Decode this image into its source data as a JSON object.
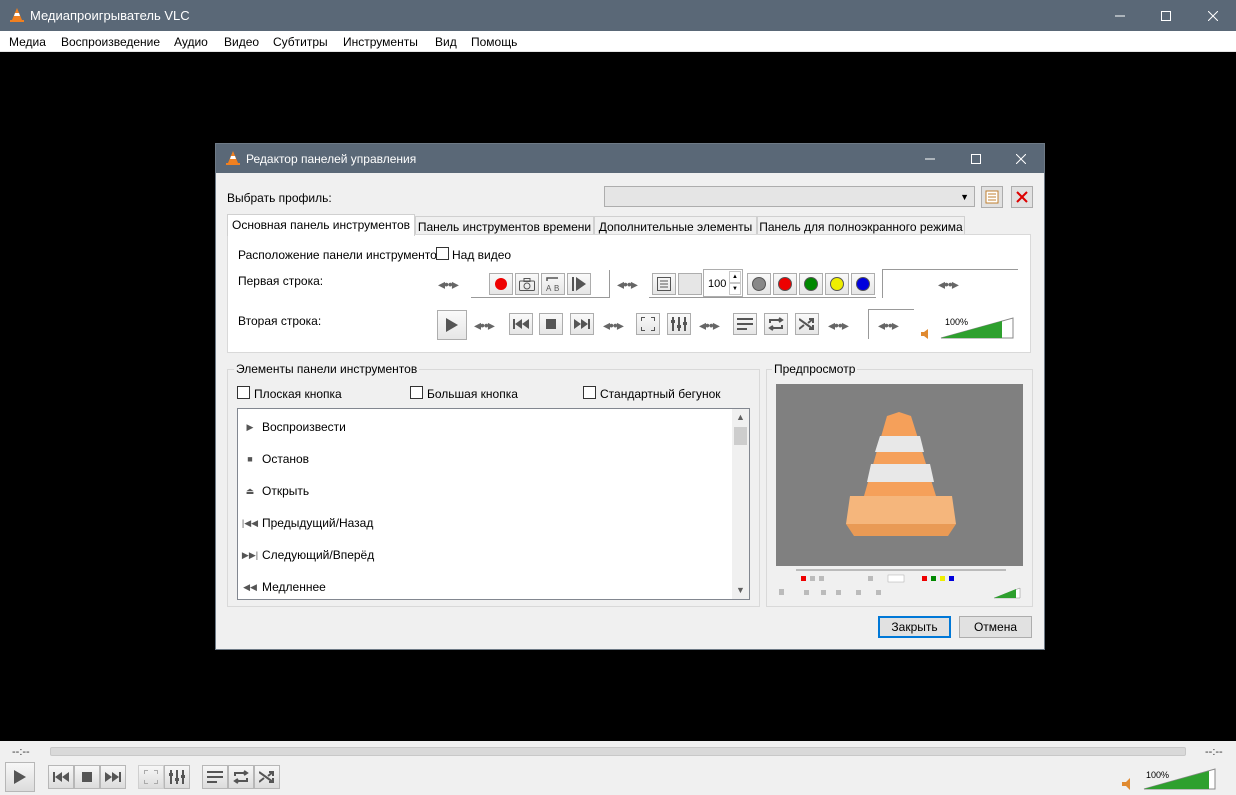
{
  "window": {
    "title": "Медиапроигрыватель VLC"
  },
  "menu": [
    "Медиа",
    "Воспроизведение",
    "Аудио",
    "Видео",
    "Субтитры",
    "Инструменты",
    "Вид",
    "Помощь"
  ],
  "player": {
    "time_elapsed": "--:--",
    "time_total": "--:--",
    "volume": "100%",
    "volume_level": 1.0
  },
  "dialog": {
    "title": "Редактор панелей управления",
    "profile_label": "Выбрать профиль:",
    "profile_value": "",
    "tabs": [
      "Основная панель инструментов",
      "Панель инструментов времени",
      "Дополнительные элементы",
      "Панель для полноэкранного режима"
    ],
    "active_tab": 0,
    "position_label": "Расположение панели инструментов:",
    "above_video_label": "Над видео",
    "row1_label": "Первая строка:",
    "row2_label": "Вторая строка:",
    "speed_value": "100",
    "row2_volume": "100%",
    "elements_group": "Элементы панели инструментов",
    "flat_button": "Плоская кнопка",
    "big_button": "Большая кнопка",
    "native_slider": "Стандартный бегунок",
    "elements": [
      {
        "icon": "play-icon",
        "label": "Воспроизвести"
      },
      {
        "icon": "stop-icon",
        "label": "Останов"
      },
      {
        "icon": "eject-icon",
        "label": "Открыть"
      },
      {
        "icon": "previous-icon",
        "label": "Предыдущий/Назад"
      },
      {
        "icon": "next-icon",
        "label": "Следующий/Вперёд"
      },
      {
        "icon": "slower-icon",
        "label": "Медленнее"
      }
    ],
    "preview_group": "Предпросмотр",
    "close_button": "Закрыть",
    "cancel_button": "Отмена"
  },
  "colors": {
    "titlebar": "#5a6877",
    "accent": "#0078d7",
    "volume_green": "#2ea02e",
    "cone_orange": "#f5a05a"
  }
}
